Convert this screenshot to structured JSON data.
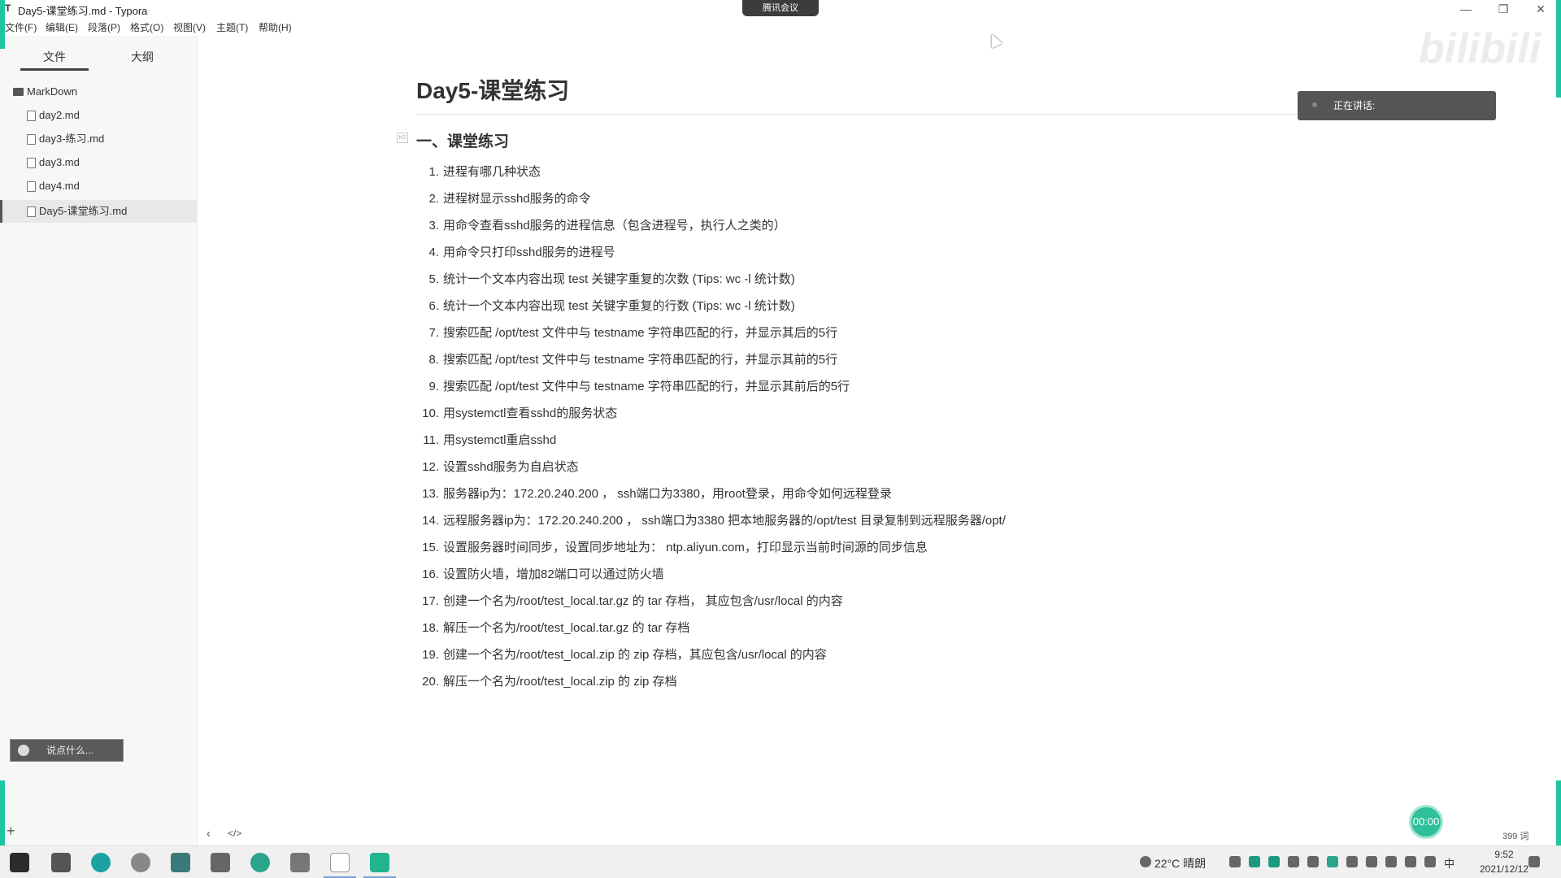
{
  "window": {
    "app_icon": "T",
    "title": "Day5-课堂练习.md - Typora",
    "minimize": "—",
    "maximize": "❐",
    "close": "✕"
  },
  "meeting_pill": "腾讯会议",
  "menu": [
    "文件(F)",
    "编辑(E)",
    "段落(P)",
    "格式(O)",
    "视图(V)",
    "主题(T)",
    "帮助(H)"
  ],
  "sidebar": {
    "tabs": {
      "files": "文件",
      "outline": "大纲"
    },
    "folder": "MarkDown",
    "files": [
      "day2.md",
      "day3-练习.md",
      "day3.md",
      "day4.md",
      "Day5-课堂练习.md"
    ],
    "active_file": "Day5-课堂练习.md",
    "danmu_placeholder": "说点什么...",
    "add": "+"
  },
  "editor": {
    "title": "Day5-课堂练习",
    "heading_marker": "H2",
    "section_heading": "一、课堂练习",
    "items": [
      "进程有哪几种状态",
      "进程树显示sshd服务的命令",
      "用命令查看sshd服务的进程信息（包含进程号，执行人之类的）",
      "用命令只打印sshd服务的进程号",
      "统计一个文本内容出现 test 关键字重复的次数 (Tips: wc -l 统计数)",
      "统计一个文本内容出现 test 关键字重复的行数 (Tips: wc -l 统计数)",
      "搜索匹配 /opt/test 文件中与 testname 字符串匹配的行，并显示其后的5行",
      "搜索匹配  /opt/test 文件中与 testname 字符串匹配的行，并显示其前的5行",
      "搜索匹配  /opt/test 文件中与 testname 字符串匹配的行，并显示其前后的5行",
      "用systemctl查看sshd的服务状态",
      "用systemctl重启sshd",
      "设置sshd服务为自启状态",
      "服务器ip为：172.20.240.200 ， ssh端口为3380，用root登录，用命令如何远程登录",
      "远程服务器ip为：172.20.240.200 ， ssh端口为3380  把本地服务器的/opt/test 目录复制到远程服务器/opt/",
      "设置服务器时间同步，设置同步地址为：  ntp.aliyun.com，打印显示当前时间源的同步信息",
      "设置防火墙，增加82端口可以通过防火墙",
      "创建一个名为/root/test_local.tar.gz 的 tar 存档，  其应包含/usr/local 的内容",
      "解压一个名为/root/test_local.tar.gz 的 tar 存档",
      "创建一个名为/root/test_local.zip 的 zip 存档，其应包含/usr/local 的内容",
      "解压一个名为/root/test_local.zip 的 zip 存档"
    ],
    "numbers": [
      "1.",
      "2.",
      "3.",
      "4.",
      "5.",
      "6.",
      "7.",
      "8.",
      "9.",
      "10.",
      "11.",
      "12.",
      "13.",
      "14.",
      "15.",
      "16.",
      "17.",
      "18.",
      "19.",
      "20."
    ]
  },
  "overlay": {
    "speaking_label": "正在讲话:",
    "watermark": "bilibili",
    "timer": "00:00"
  },
  "status": {
    "back": "‹",
    "source": "</>",
    "word_count": "399 词"
  },
  "taskbar": {
    "weather": "22°C  晴朗",
    "ime": "中",
    "time": "9:52",
    "date": "2021/12/12"
  },
  "colors": {
    "accent_teal": "#1cc6a0",
    "sidebar_bg": "#f7f7f7"
  }
}
